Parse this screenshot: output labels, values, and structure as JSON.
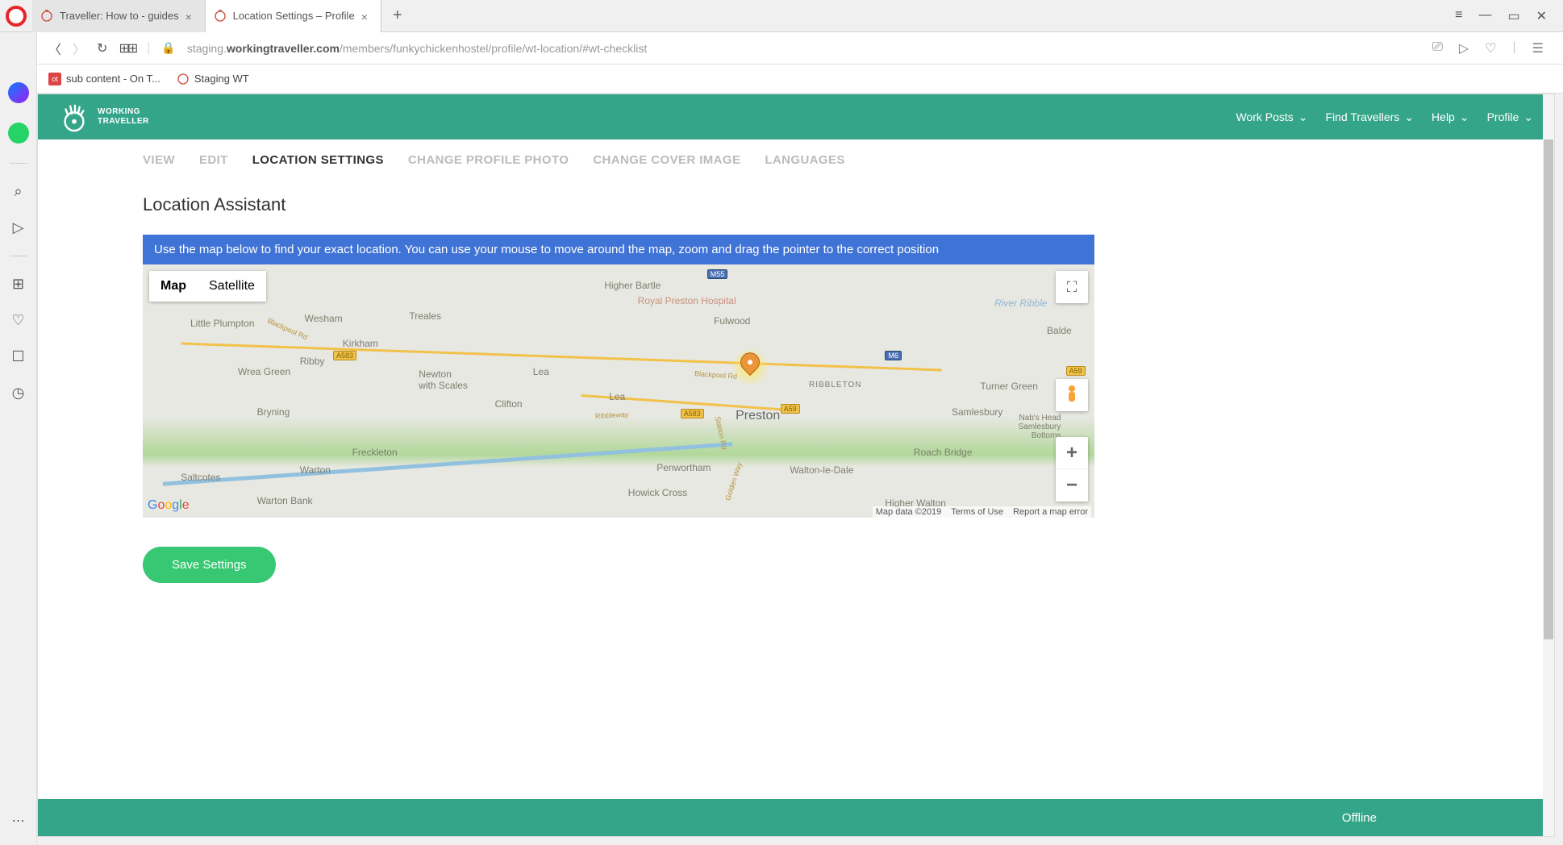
{
  "browser": {
    "tab1": {
      "title": "Traveller: How to - guides"
    },
    "tab2": {
      "title": "Location Settings – Profile"
    },
    "url_prefix": "staging.",
    "url_host": "workingtraveller.com",
    "url_path": "/members/funkychickenhostel/profile/wt-location/#wt-checklist",
    "bookmarks": {
      "b1": "sub content - On T...",
      "b2": "Staging WT"
    }
  },
  "site": {
    "logo_line1": "WORKING",
    "logo_line2": "TRAVELLER",
    "nav": {
      "work_posts": "Work Posts",
      "find_travellers": "Find Travellers",
      "help": "Help",
      "profile": "Profile"
    }
  },
  "tabs": {
    "view": "VIEW",
    "edit": "EDIT",
    "location": "LOCATION SETTINGS",
    "photo": "CHANGE PROFILE PHOTO",
    "cover": "CHANGE COVER IMAGE",
    "languages": "LANGUAGES"
  },
  "page": {
    "title": "Location Assistant",
    "banner_text": "Use the map below to find your exact location. You can use your mouse to move around the map, zoom and drag the pointer to the correct position",
    "save_button": "Save Settings"
  },
  "map": {
    "map_button": "Map",
    "satellite_button": "Satellite",
    "labels": {
      "preston": "Preston",
      "higher_bartle": "Higher Bartle",
      "hospital": "Royal Preston Hospital",
      "fulwood": "Fulwood",
      "balde": "Balde",
      "ribbleton": "RIBBLETON",
      "turner_green": "Turner Green",
      "samlesbury": "Samlesbury",
      "nabs_head": "Nab's Head\nSamlesbury\nBottoms",
      "roach_bridge": "Roach Bridge",
      "walton": "Walton-le-Dale",
      "higher_walton": "Higher Walton",
      "penwortham": "Penwortham",
      "howick": "Howick Cross",
      "lea": "Lea",
      "lea2": "Lea",
      "clifton": "Clifton",
      "newton": "Newton\nwith Scales",
      "freckleton": "Freckleton",
      "bryning": "Bryning",
      "wrea_green": "Wrea Green",
      "kirkham": "Kirkham",
      "wesham": "Wesham",
      "treales": "Treales",
      "ribby": "Ribby",
      "little_plumpton": "Little\nPlumpton",
      "saltcotes": "Saltcotes",
      "warton": "Warton",
      "warton_bank": "Warton Bank",
      "river_ribble": "River Ribble"
    },
    "road_tags": {
      "a583": "A583",
      "a583_2": "A583",
      "a59": "A59",
      "a59_2": "A59",
      "m55": "M55",
      "m6": "M6"
    },
    "road_names": {
      "blackpool1": "Blackpool Rd",
      "blackpool2": "Blackpool Rd",
      "ribbleway": "Ribbleway",
      "station": "Station Rd",
      "golden": "Golden Way"
    },
    "attr": {
      "data": "Map data ©2019",
      "terms": "Terms of Use",
      "report": "Report a map error"
    }
  },
  "footer": {
    "status": "Offline"
  }
}
